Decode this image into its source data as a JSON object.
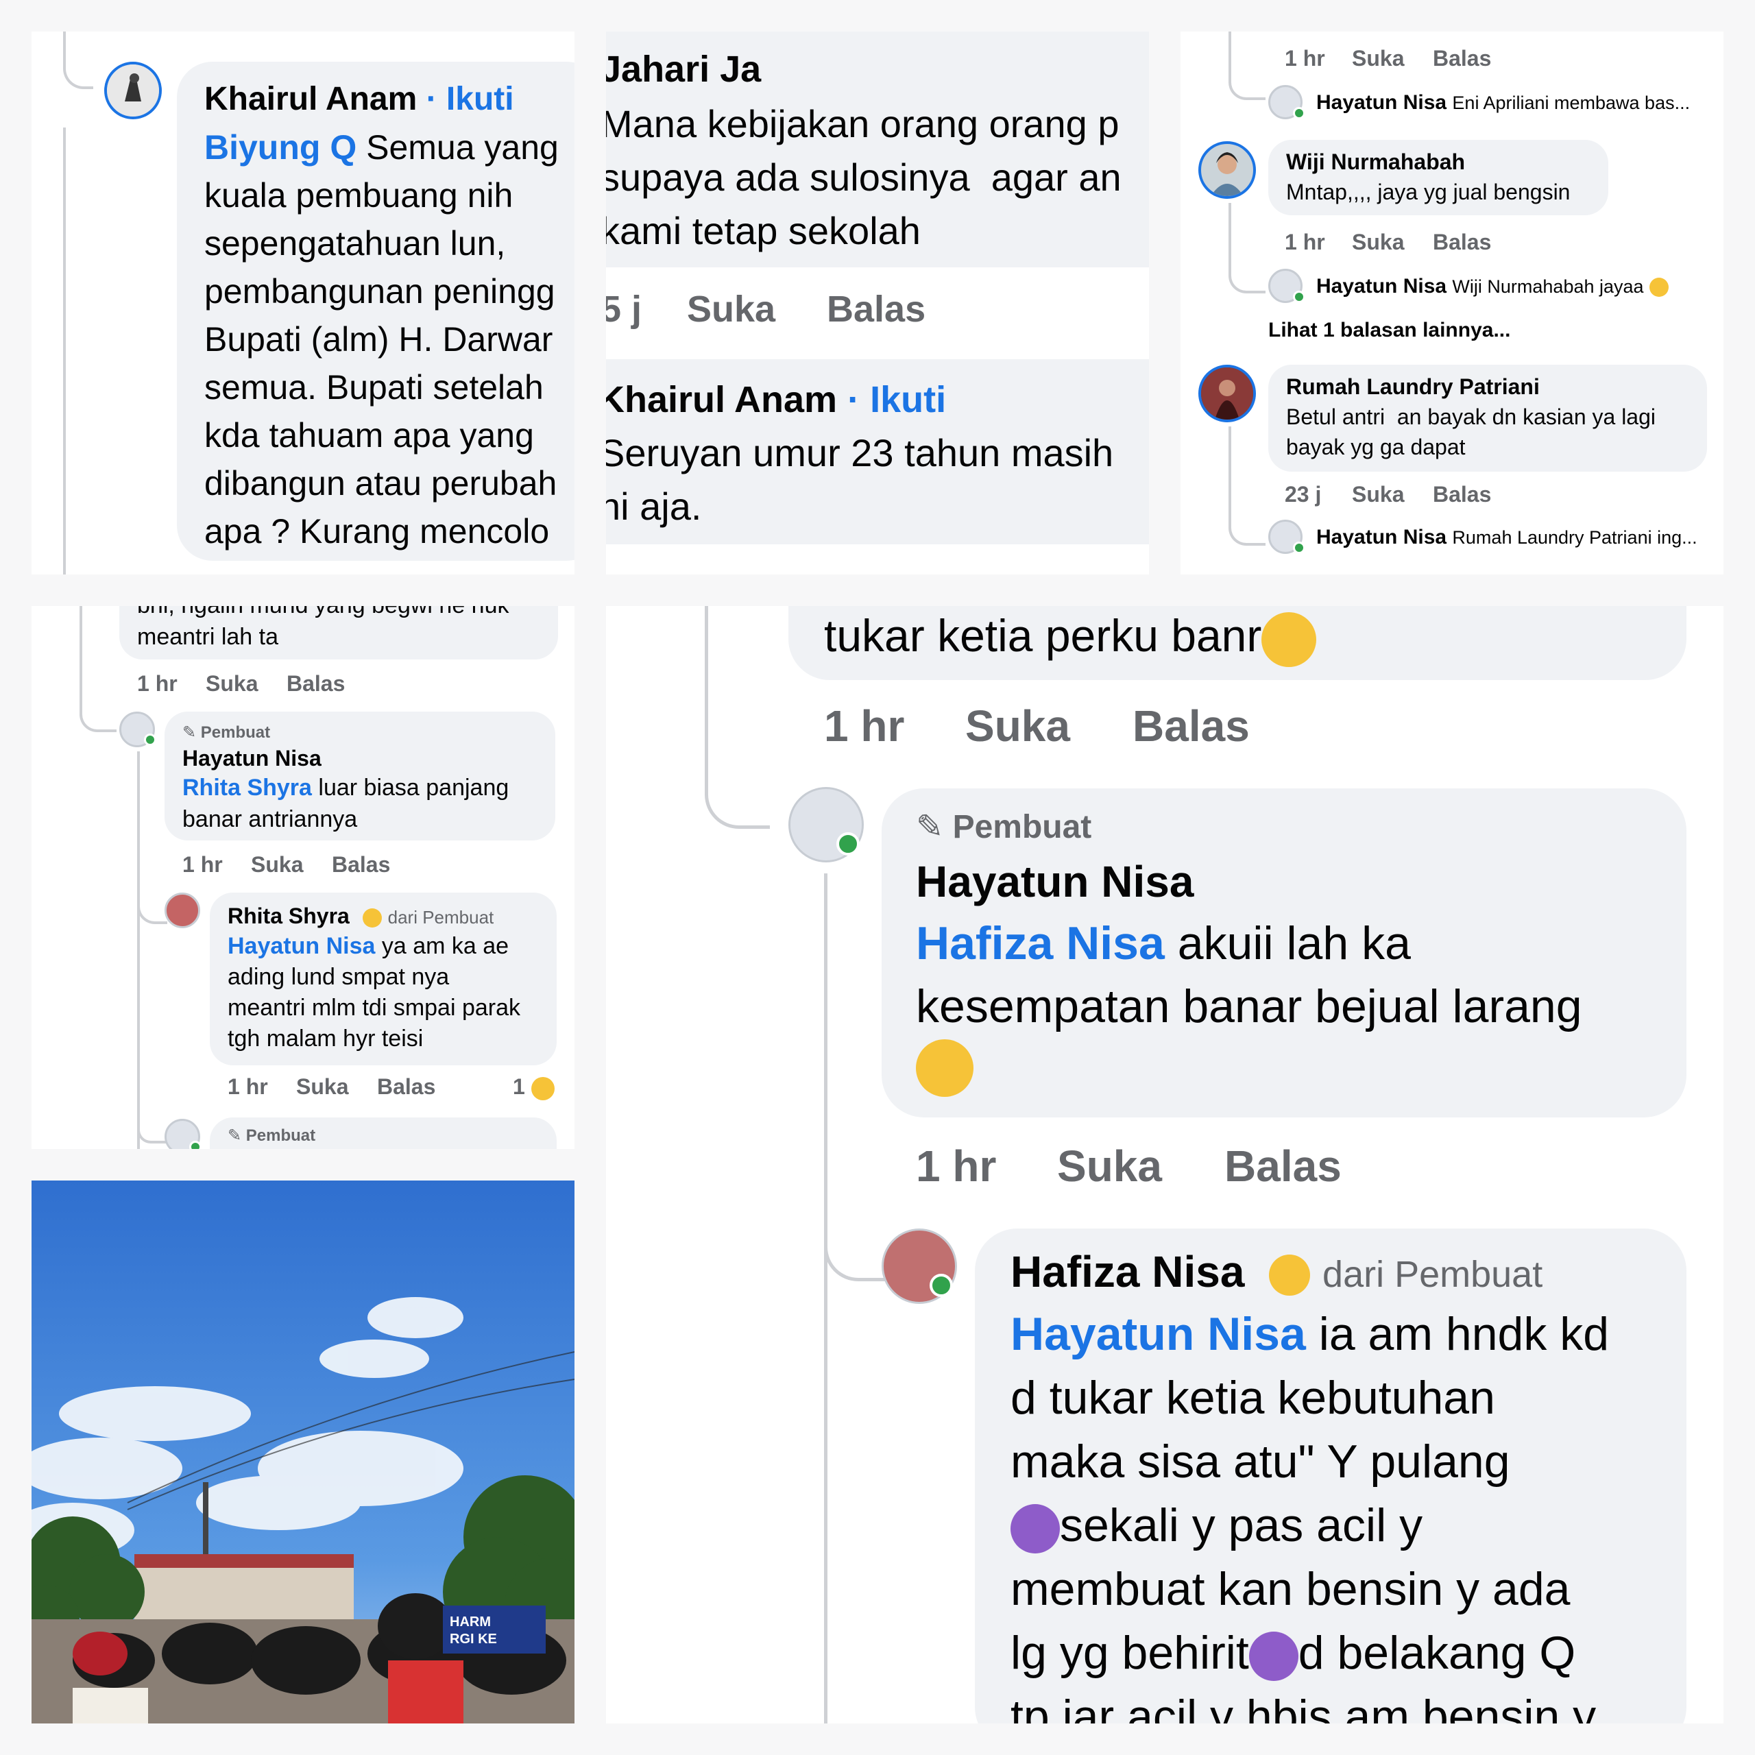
{
  "panel1": {
    "name": "Khairul Anam",
    "follow": "· Ikuti",
    "mention": "Biyung Q",
    "text": " Semua yang\nkuala pembuang nih\nsepengatahuan lun,\npembangunan peningg\nBupati (alm) H. Darwar\nsemua. Bupati setelah\nkda tahuam apa yang\ndibangun atau perubah\napa ? Kurang mencolo"
  },
  "panel2": {
    "c1": {
      "name": "Jahari Ja",
      "text": "Mana kebijakan orang orang p\nsupaya ada sulosinya  agar an\nkami tetap sekolah"
    },
    "c1_actions": {
      "time": "5 j",
      "like": "Suka",
      "reply": "Balas"
    },
    "c2": {
      "name": "Khairul Anam",
      "follow": "· Ikuti",
      "text": "Seruyan umur 23 tahun masih\nni aja."
    }
  },
  "panel3": {
    "a1": {
      "time": "1 hr",
      "like": "Suka",
      "reply": "Balas"
    },
    "r1": {
      "name": "Hayatun Nisa",
      "text": "Eni Apriliani membawa bas..."
    },
    "c1": {
      "name": "Wiji Nurmahabah",
      "text": "Mntap,,,, jaya yg jual bengsin"
    },
    "a2": {
      "time": "1 hr",
      "like": "Suka",
      "reply": "Balas"
    },
    "r2": {
      "name": "Hayatun Nisa",
      "text": "Wiji Nurmahabah jayaa"
    },
    "more": "Lihat 1 balasan lainnya...",
    "c2": {
      "name": "Rumah Laundry Patriani",
      "text": "Betul antri  an bayak dn kasian ya lagi\nbayak yg ga dapat"
    },
    "a3": {
      "time": "23 j",
      "like": "Suka",
      "reply": "Balas"
    },
    "r3": {
      "name": "Hayatun Nisa",
      "text": "Rumah Laundry Patriani ing..."
    }
  },
  "panel4": {
    "top_text": "bhi, ngalih mund yang begwi ne huk\nmeantri lah ta",
    "a1": {
      "time": "1 hr",
      "like": "Suka",
      "reply": "Balas"
    },
    "c1": {
      "badge": "Pembuat",
      "name": "Hayatun Nisa",
      "mention": "Rhita Shyra",
      "text": " luar biasa panjang\nbanar antriannya"
    },
    "a2": {
      "time": "1 hr",
      "like": "Suka",
      "reply": "Balas"
    },
    "c2": {
      "name": "Rhita Shyra",
      "from": "dari Pembuat",
      "mention": "Hayatun Nisa",
      "text": " ya am ka ae\nading lund smpat nya\nmeantri mlm tdi smpai parak\ntgh malam hyr teisi"
    },
    "a3": {
      "time": "1 hr",
      "like": "Suka",
      "reply": "Balas",
      "count": "1"
    },
    "c3": {
      "badge": "Pembuat"
    }
  },
  "panel5": {
    "top_text": "tukar ketia perku banr",
    "a1": {
      "time": "1 hr",
      "like": "Suka",
      "reply": "Balas"
    },
    "c1": {
      "badge": "Pembuat",
      "name": "Hayatun Nisa",
      "mention": "Hafiza Nisa",
      "text": " akuii lah ka\nkesempatan banar bejual larang"
    },
    "a2": {
      "time": "1 hr",
      "like": "Suka",
      "reply": "Balas"
    },
    "c2": {
      "name": "Hafiza Nisa",
      "from": "dari Pembuat",
      "mention": "Hayatun Nisa",
      "l1": " ia am hndk kd",
      "l2": "d tukar ketia kebutuhan",
      "l3": "maka sisa atu\" Y pulang",
      "l4": "sekali y pas acil y",
      "l5": "membuat kan bensin y ada",
      "l6a": "lg yg behirit",
      "l6b": "d belakang Q",
      "l7": "tp iar acil y hbis am bensin y"
    }
  },
  "photo": {
    "banner": "HARM\nRGI KE"
  },
  "colors": {
    "accent": "#1b74e4",
    "bubble": "#f0f2f5",
    "muted": "#65676b",
    "online": "#31a24c"
  },
  "icons": [
    "pencil-icon",
    "emoji-icon",
    "avatar",
    "online-dot-icon"
  ]
}
